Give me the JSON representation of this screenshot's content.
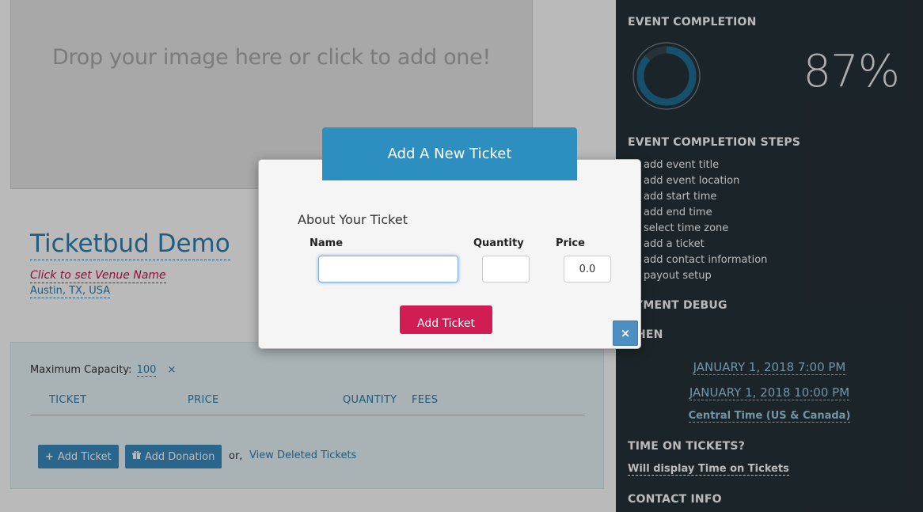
{
  "dropzone": {
    "text": "Drop your image here or click to add one!"
  },
  "event": {
    "title": "Ticketbud Demo",
    "venue_name": "Click to set Venue Name",
    "location": "Austin, TX, USA"
  },
  "tickets": {
    "capacity_label": "Maximum Capacity:",
    "capacity_value": "100",
    "remove_symbol": "×",
    "columns": [
      "TICKET",
      "PRICE",
      "QUANTITY",
      "FEES"
    ],
    "add_ticket_icon": "+",
    "add_ticket_label": "Add Ticket",
    "add_donation_icon": "gift-icon",
    "add_donation_label": "Add Donation",
    "or_text": "or,",
    "view_deleted_label": "View Deleted Tickets"
  },
  "sidebar": {
    "completion_heading": "EVENT COMPLETION",
    "completion_percent": "87%",
    "completion_fraction": 0.87,
    "steps_heading": "EVENT COMPLETION STEPS",
    "steps": [
      "add event title",
      "add event location",
      "add start time",
      "add end time",
      "select time zone",
      "add a ticket",
      "add contact information",
      "payout setup"
    ],
    "payment_heading": "YMENT DEBUG",
    "when_heading": "HEN",
    "start_time": "JANUARY 1, 2018 7:00 PM",
    "end_time": "JANUARY 1, 2018 10:00 PM",
    "time_zone": "Central Time (US & Canada)",
    "time_on_tickets_heading": "TIME ON TICKETS?",
    "time_on_tickets_value": "Will display Time on Tickets",
    "contact_heading": "CONTACT INFO"
  },
  "modal": {
    "title": "Add A New Ticket",
    "subtitle": "About Your Ticket",
    "name_label": "Name",
    "quantity_label": "Quantity",
    "price_label": "Price",
    "name_value": "",
    "quantity_value": "",
    "price_value": "0.0",
    "submit_label": "Add Ticket",
    "close_symbol": "×"
  },
  "colors": {
    "accent_blue": "#2d8fbf",
    "submit_pink": "#d11d53",
    "sidebar_bg": "#263238",
    "donut_ring": "#1f6e95"
  }
}
